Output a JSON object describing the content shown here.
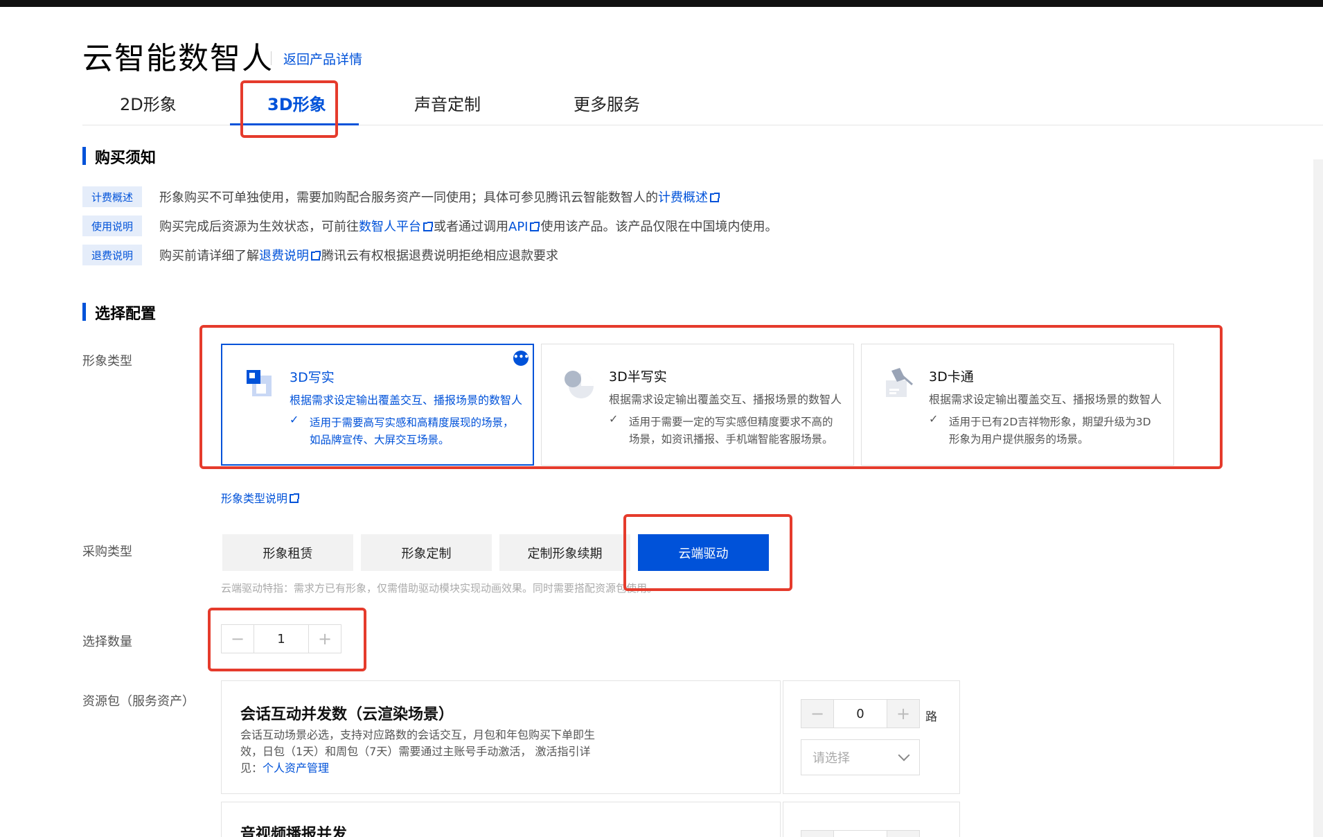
{
  "header": {
    "title": "云智能数智人",
    "back_link": "返回产品详情"
  },
  "tabs": [
    {
      "label": "2D形象"
    },
    {
      "label": "3D形象"
    },
    {
      "label": "声音定制"
    },
    {
      "label": "更多服务"
    }
  ],
  "notice": {
    "section_title": "购买须知",
    "rows": [
      {
        "badge": "计费概述",
        "text_before": "形象购买不可单独使用，需要加购配合服务资产一同使用；具体可参见腾讯云智能数智人的",
        "link": "计费概述",
        "text_after": ""
      },
      {
        "badge": "使用说明",
        "text_before": "购买完成后资源为生效状态，可前往",
        "link": "数智人平台",
        "text_mid": "或者通过调用",
        "link2": "API",
        "text_after": "使用该产品。该产品仅限在中国境内使用。"
      },
      {
        "badge": "退费说明",
        "text_before": "购买前请详细了解",
        "link": "退费说明",
        "text_after": "腾讯云有权根据退费说明拒绝相应退款要求"
      }
    ]
  },
  "config": {
    "section_title": "选择配置",
    "avatar_type_label": "形象类型",
    "avatar_types": [
      {
        "title": "3D写实",
        "desc": "根据需求设定输出覆盖交互、播报场景的数智人",
        "note": "适用于需要高写实感和高精度展现的场景，如品牌宣传、大屏交互场景。"
      },
      {
        "title": "3D半写实",
        "desc": "根据需求设定输出覆盖交互、播报场景的数智人",
        "note": "适用于需要一定的写实感但精度要求不高的场景，如资讯播报、手机端智能客服场景。"
      },
      {
        "title": "3D卡通",
        "desc": "根据需求设定输出覆盖交互、播报场景的数智人",
        "note": "适用于已有2D吉祥物形象，期望升级为3D形象为用户提供服务的场景。"
      }
    ],
    "more_icon": "more-icon",
    "check_icon": "✓",
    "type_help_link": "形象类型说明",
    "purchase_type_label": "采购类型",
    "purchase_types": [
      {
        "label": "形象租赁"
      },
      {
        "label": "形象定制"
      },
      {
        "label": "定制形象续期"
      },
      {
        "label": "云端驱动"
      }
    ],
    "purchase_hint": "云端驱动特指：需求方已有形象，仅需借助驱动模块实现动画效果。同时需要搭配资源包使用。",
    "quantity_label": "选择数量",
    "quantity_value": "1",
    "minus": "−",
    "plus": "+",
    "resource_label": "资源包（服务资产）",
    "resources": [
      {
        "title": "会话互动并发数（云渲染场景）",
        "desc_before": "会话互动场景必选，支持对应路数的会话交互，月包和年包购买下单即生效，日包（1天）和周包（7天）需要通过主账号手动激活， 激活指引详见：",
        "desc_link": "个人资产管理",
        "count": "0",
        "unit": "路",
        "select_placeholder": "请选择"
      },
      {
        "title": "音视频播报并发"
      }
    ]
  },
  "colors": {
    "accent": "#0052d9",
    "highlight_red": "#e53b2c"
  }
}
